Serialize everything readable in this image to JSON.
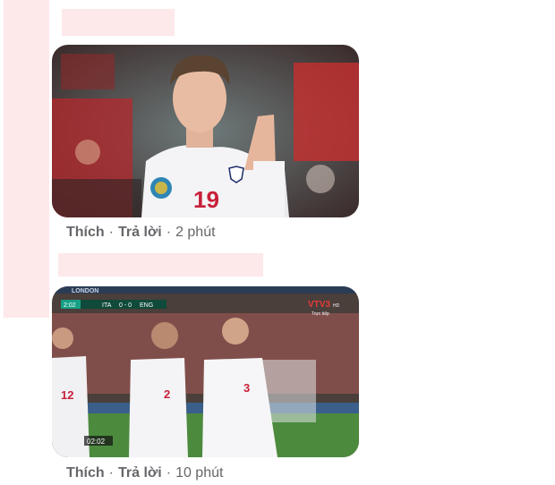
{
  "comments": [
    {
      "image_alt": "Cầu thủ tuyển Anh số 19 vỗ tay",
      "actions": {
        "like": "Thích",
        "reply": "Trả lời",
        "time": "2 phút"
      }
    },
    {
      "image_alt": "Cầu thủ tuyển Anh ăn mừng bàn thắng",
      "scoreboard": {
        "clock": "2:02",
        "home": "ITA",
        "score": "0 - 0",
        "away": "ENG"
      },
      "broadcaster": {
        "logo": "VTV3",
        "sub": "HD",
        "live": "Trực tiếp"
      },
      "replay_time": "02:02",
      "stadium_text": "LONDON",
      "actions": {
        "like": "Thích",
        "reply": "Trả lời",
        "time": "10 phút"
      }
    }
  ],
  "jerseys": {
    "player1": "19",
    "player_left": "12",
    "player_mid": "2",
    "player_right": "3"
  },
  "colors": {
    "placeholder": "#fde8ea",
    "meta_text": "#65676b"
  }
}
